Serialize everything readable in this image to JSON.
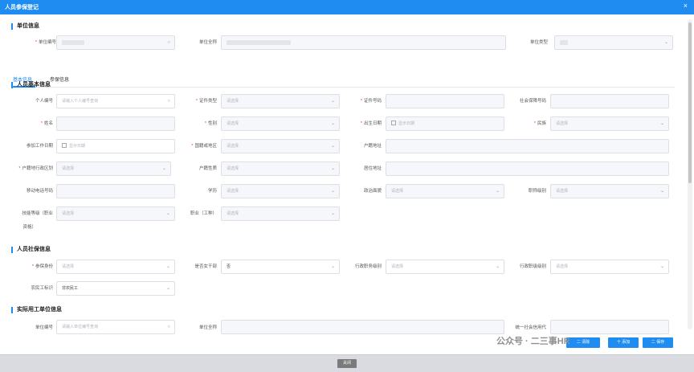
{
  "window": {
    "title": "人员参保登记",
    "close": "×"
  },
  "unit_section": {
    "title": "单位信息",
    "unit_no_label": "单位编号",
    "unit_name_label": "单位全称",
    "unit_type_label": "单位类型"
  },
  "tabs": [
    {
      "label": "基本信息"
    },
    {
      "label": "参保信息"
    }
  ],
  "basic_section": {
    "title": "人员基本信息",
    "person_no": {
      "label": "个人编号",
      "placeholder": "请输入个人编号查询"
    },
    "id_type": {
      "label": "证件类型",
      "placeholder": "请选择"
    },
    "id_no": {
      "label": "证件号码"
    },
    "ssn": {
      "label": "社会保障号码"
    },
    "name": {
      "label": "姓名"
    },
    "gender": {
      "label": "性别",
      "placeholder": "请选择"
    },
    "birth_date": {
      "label": "出生日期",
      "placeholder": "显示日期"
    },
    "ethnicity": {
      "label": "民族",
      "placeholder": "请选择"
    },
    "work_start": {
      "label": "参加工作日期",
      "placeholder": "显示日期"
    },
    "country": {
      "label": "国籍或地区",
      "placeholder": "请选择"
    },
    "hukou_addr": {
      "label": "户籍地址"
    },
    "hukou_region": {
      "label": "户籍地行政区划",
      "placeholder": "请选择"
    },
    "hukou_type": {
      "label": "户籍性质",
      "placeholder": "请选择"
    },
    "residence": {
      "label": "居住地址"
    },
    "mobile": {
      "label": "移动电话号码"
    },
    "education": {
      "label": "学历",
      "placeholder": "请选择"
    },
    "political": {
      "label": "政治面貌",
      "placeholder": "请选择"
    },
    "title_level": {
      "label": "职称级别",
      "placeholder": "请选择"
    },
    "skill_level": {
      "label_1": "技能等级（职业",
      "label_2": "资格）",
      "placeholder": "请选择"
    },
    "occupation": {
      "label": "职业（工种）",
      "placeholder": "请选择"
    }
  },
  "insured_section": {
    "title": "人员社保信息",
    "insured_identity": {
      "label": "参保身份",
      "placeholder": "请选择"
    },
    "female_cadre": {
      "label": "是否女干部",
      "value": "否"
    },
    "admin_post": {
      "label": "行政职务级别",
      "placeholder": "请选择"
    },
    "admin_rank": {
      "label": "行政职级级别",
      "placeholder": "请选择"
    },
    "migrant": {
      "label": "农民工标识",
      "value": "非农民工"
    }
  },
  "actual_section": {
    "title": "实际用工单位信息",
    "unit_no": {
      "label": "单位编号",
      "placeholder": "请输入单位编号查询"
    },
    "unit_name": {
      "label": "单位全称"
    },
    "credit_code": {
      "label": "统一社会信用代"
    }
  },
  "footer": {
    "close_label": "关闭"
  },
  "overlay_buttons": [
    "二 清除",
    "十 添加",
    "二 保存"
  ],
  "watermark": "公众号 · 二三事HR",
  "colors": {
    "primary": "#1e8cf0",
    "required": "#e33333"
  }
}
